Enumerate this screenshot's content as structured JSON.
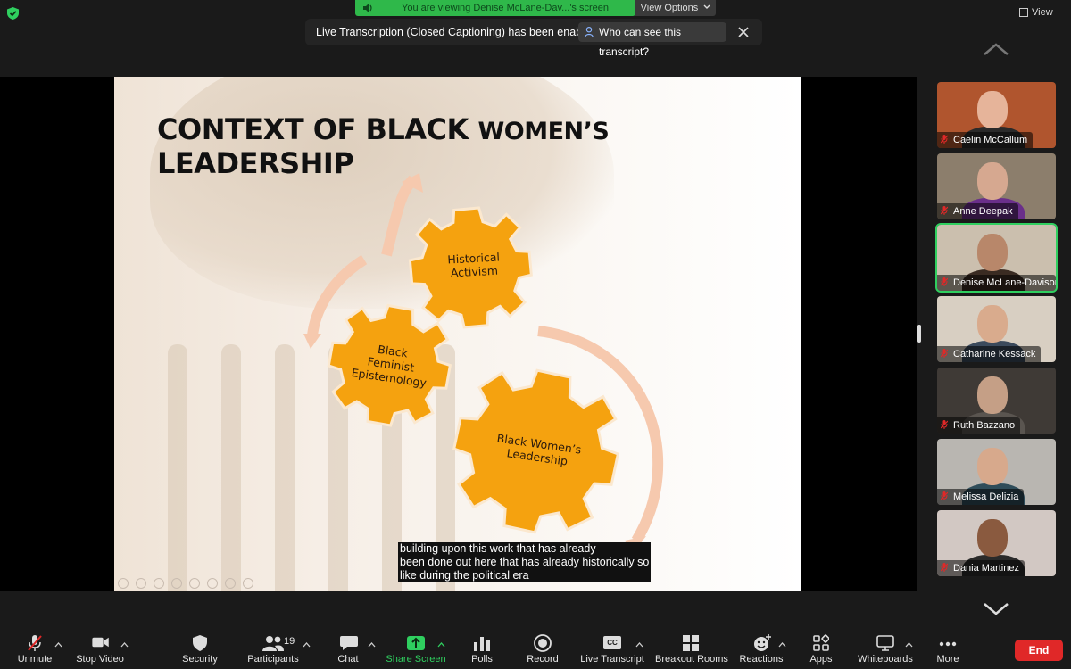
{
  "share_banner": {
    "text": "You are viewing Denise McLane-Dav...'s screen",
    "view_options": "View Options"
  },
  "view_button": "View",
  "live_toast": {
    "message": "Live Transcription (Closed Captioning) has been enabled",
    "who_button": "Who can see this transcript?"
  },
  "slide": {
    "title_a": "CONTEXT OF BLACK ",
    "title_b": "WOMEN’S",
    "title_c": " LEADERSHIP",
    "gears": [
      {
        "line1": "Historical",
        "line2": "Activism",
        "line3": ""
      },
      {
        "line1": "Black",
        "line2": "Feminist",
        "line3": "Epistemology"
      },
      {
        "line1": "Black Women’s",
        "line2": "Leadership",
        "line3": ""
      }
    ]
  },
  "caption": [
    "building upon this work that has already",
    "been done out here that has already historically so",
    "like during the political era"
  ],
  "participants": [
    {
      "name": "Caelin McCallum",
      "bg": "#b0552e",
      "face": "#e6b49a",
      "body": "#2a2a2a"
    },
    {
      "name": "Anne Deepak",
      "bg": "#8c7e6c",
      "face": "#d6a890",
      "body": "#6a2f8a"
    },
    {
      "name": "Denise McLane-Davison...",
      "bg": "#cbbfae",
      "face": "#b8876a",
      "body": "#3a2b22",
      "active": true
    },
    {
      "name": "Catharine Kessack",
      "bg": "#d8cfc2",
      "face": "#d9ab8d",
      "body": "#3b4a5c"
    },
    {
      "name": "Ruth Bazzano",
      "bg": "#3f3a36",
      "face": "#c59f86",
      "body": "#5a5550"
    },
    {
      "name": "Melissa Delizia",
      "bg": "#b9b6b1",
      "face": "#d7a98c",
      "body": "#2f4d5a"
    },
    {
      "name": "Dania Martinez",
      "bg": "#d2c8c3",
      "face": "#8a5a3f",
      "body": "#2a2a2a"
    }
  ],
  "toolbar": {
    "unmute": "Unmute",
    "stop_video": "Stop Video",
    "security": "Security",
    "participants": "Participants",
    "participant_count": "19",
    "chat": "Chat",
    "share_screen": "Share Screen",
    "polls": "Polls",
    "record": "Record",
    "live_transcript": "Live Transcript",
    "cc": "CC",
    "breakout_rooms": "Breakout Rooms",
    "reactions": "Reactions",
    "apps": "Apps",
    "whiteboards": "Whiteboards",
    "more": "More",
    "end": "End"
  },
  "colors": {
    "accent_green": "#2fcf5f",
    "end_red": "#e02828",
    "gear_orange": "#f5a20f"
  }
}
